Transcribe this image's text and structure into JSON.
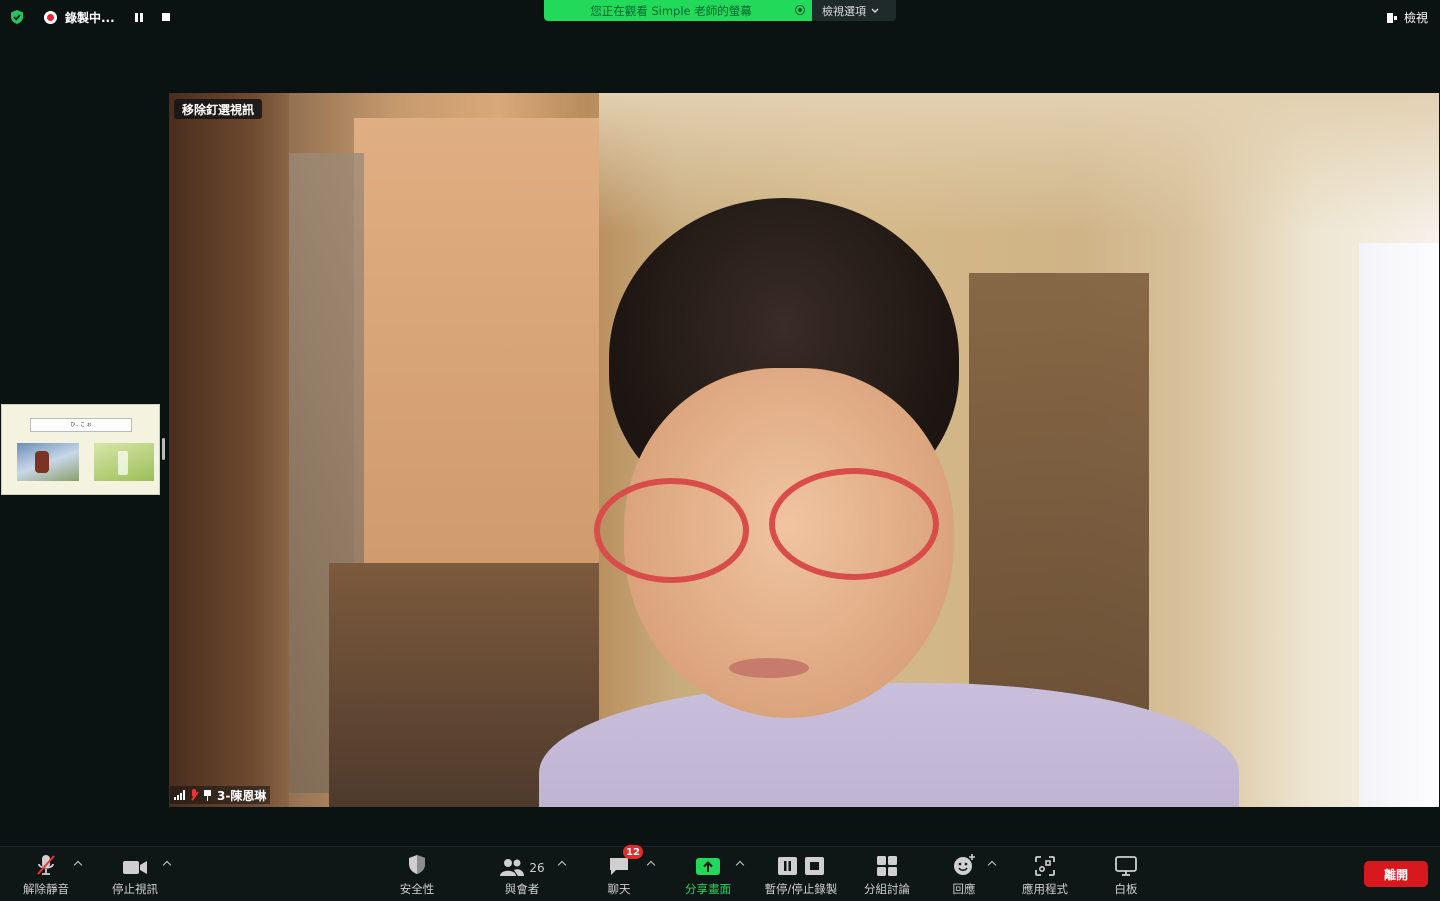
{
  "recording": {
    "label": "錄製中..."
  },
  "share_banner": {
    "text": "您正在觀看 Simple 老師的螢幕",
    "options_label": "檢視選項"
  },
  "view_button": {
    "label": "檢視"
  },
  "thumbnail": {
    "title_text": "ひ.. こ ぉ"
  },
  "video": {
    "pinned_label": "移除釘選視訊",
    "participant_name": "3-陳恩琳"
  },
  "toolbar": {
    "unmute": "解除靜音",
    "stop_video": "停止視訊",
    "security": "安全性",
    "participants": "與會者",
    "participants_count": "26",
    "chat": "聊天",
    "chat_badge": "12",
    "share_screen": "分享畫面",
    "pause_record": "暫停/停止錄製",
    "breakout": "分組討論",
    "reactions": "回應",
    "apps": "應用程式",
    "whiteboard": "白板",
    "leave": "離開"
  },
  "colors": {
    "share_green": "#23d959",
    "leave_red": "#d7191f",
    "badge_red": "#e22b2b",
    "background": "#0b1212"
  },
  "icons": [
    "shield-check-icon",
    "record-icon",
    "pause-icon",
    "stop-icon",
    "target-icon",
    "chevron-down-icon",
    "view-icon",
    "mic-muted-icon",
    "video-icon",
    "shield-icon",
    "participants-icon",
    "chat-icon",
    "share-screen-icon",
    "pause-stop-record-icon",
    "breakout-icon",
    "reaction-icon",
    "apps-icon",
    "whiteboard-icon",
    "signal-icon",
    "pin-icon"
  ]
}
